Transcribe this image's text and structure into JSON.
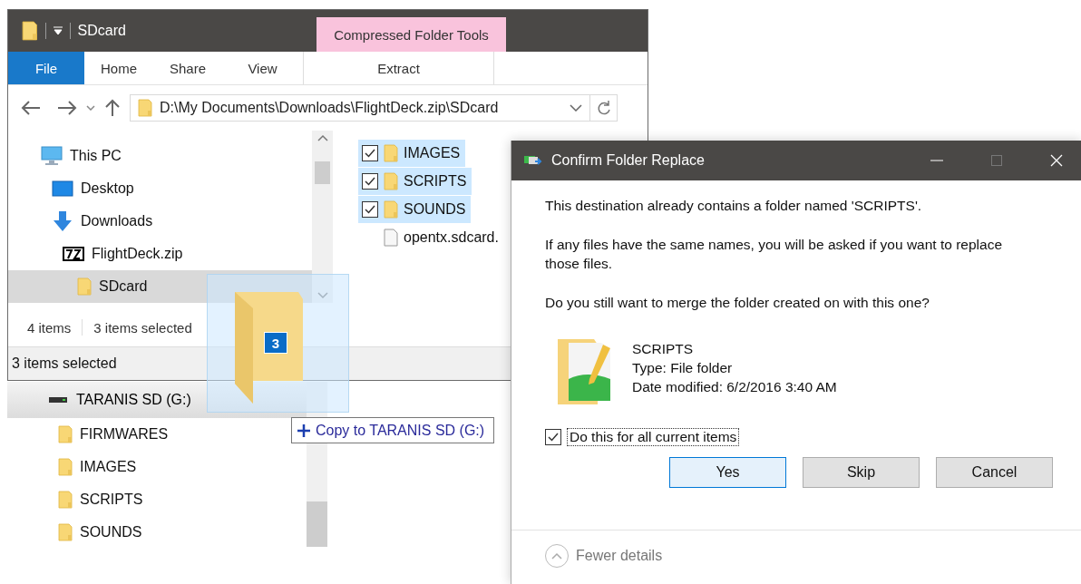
{
  "explorer": {
    "title": "SDcard",
    "context_tab": "Compressed Folder Tools",
    "ribbon_tabs": [
      {
        "label": "File",
        "selected": true
      },
      {
        "label": "Home",
        "selected": false
      },
      {
        "label": "Share",
        "selected": false
      },
      {
        "label": "View",
        "selected": false
      },
      {
        "label": "Extract",
        "selected": false
      }
    ],
    "address": "D:\\My Documents\\Downloads\\FlightDeck.zip\\SDcard",
    "nav_items": [
      {
        "label": "This PC",
        "kind": "pc",
        "selected": false,
        "children": [
          {
            "label": "Desktop",
            "kind": "desktop",
            "selected": false
          },
          {
            "label": "Downloads",
            "kind": "downloads",
            "selected": false,
            "children": [
              {
                "label": "FlightDeck.zip",
                "kind": "zip",
                "selected": false,
                "children": [
                  {
                    "label": "SDcard",
                    "kind": "folder",
                    "selected": true
                  }
                ]
              }
            ]
          }
        ]
      }
    ],
    "files": [
      {
        "name": "IMAGES",
        "kind": "folder",
        "checked": true,
        "selected": true
      },
      {
        "name": "SCRIPTS",
        "kind": "folder",
        "checked": true,
        "selected": true
      },
      {
        "name": "SOUNDS",
        "kind": "folder",
        "checked": true,
        "selected": true
      },
      {
        "name": "opentx.sdcard.",
        "kind": "file",
        "checked": false,
        "selected": false
      }
    ],
    "item_count": "4 items",
    "selected_count": "3 items selected",
    "status": "3 items selected"
  },
  "drive_tree": {
    "label": "TARANIS SD (G:)",
    "selected": true,
    "children": [
      {
        "label": "FIRMWARES"
      },
      {
        "label": "IMAGES"
      },
      {
        "label": "SCRIPTS"
      },
      {
        "label": "SOUNDS"
      }
    ]
  },
  "drag": {
    "count": "3",
    "tooltip": "Copy to TARANIS SD (G:)"
  },
  "dialog": {
    "title": "Confirm Folder Replace",
    "paragraphs": [
      "This destination already contains a folder named 'SCRIPTS'.",
      "If any files have the same names, you will be asked if you want to replace those files.",
      "Do you still want to merge the folder created on  with this one?"
    ],
    "item": {
      "name": "SCRIPTS",
      "type": "Type: File folder",
      "modified": "Date modified: 6/2/2016 3:40 AM"
    },
    "checkbox": {
      "label": "Do this for all current items",
      "checked": true
    },
    "buttons": [
      {
        "label": "Yes",
        "default": true
      },
      {
        "label": "Skip",
        "default": false
      },
      {
        "label": "Cancel",
        "default": false
      }
    ],
    "details_toggle": "Fewer details"
  }
}
